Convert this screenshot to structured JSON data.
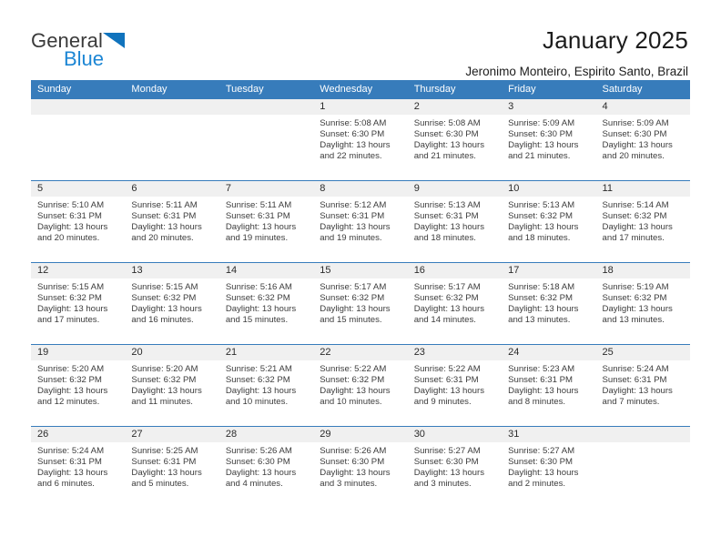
{
  "brand": {
    "name_part1": "General",
    "name_part2": "Blue",
    "triangle_color": "#1073bd",
    "blue_color": "#1c86d4"
  },
  "header": {
    "title": "January 2025",
    "subtitle": "Jeronimo Monteiro, Espirito Santo, Brazil"
  },
  "calendar": {
    "header_bg": "#377cbb",
    "daynum_bg": "#f0f0f0",
    "weekday_headers": [
      "Sunday",
      "Monday",
      "Tuesday",
      "Wednesday",
      "Thursday",
      "Friday",
      "Saturday"
    ],
    "weeks": [
      [
        {
          "day": "",
          "empty": true,
          "sunrise": "",
          "sunset": "",
          "daylight1": "",
          "daylight2": ""
        },
        {
          "day": "",
          "empty": true,
          "sunrise": "",
          "sunset": "",
          "daylight1": "",
          "daylight2": ""
        },
        {
          "day": "",
          "empty": true,
          "sunrise": "",
          "sunset": "",
          "daylight1": "",
          "daylight2": ""
        },
        {
          "day": "1",
          "empty": false,
          "sunrise": "Sunrise: 5:08 AM",
          "sunset": "Sunset: 6:30 PM",
          "daylight1": "Daylight: 13 hours",
          "daylight2": "and 22 minutes."
        },
        {
          "day": "2",
          "empty": false,
          "sunrise": "Sunrise: 5:08 AM",
          "sunset": "Sunset: 6:30 PM",
          "daylight1": "Daylight: 13 hours",
          "daylight2": "and 21 minutes."
        },
        {
          "day": "3",
          "empty": false,
          "sunrise": "Sunrise: 5:09 AM",
          "sunset": "Sunset: 6:30 PM",
          "daylight1": "Daylight: 13 hours",
          "daylight2": "and 21 minutes."
        },
        {
          "day": "4",
          "empty": false,
          "sunrise": "Sunrise: 5:09 AM",
          "sunset": "Sunset: 6:30 PM",
          "daylight1": "Daylight: 13 hours",
          "daylight2": "and 20 minutes."
        }
      ],
      [
        {
          "day": "5",
          "empty": false,
          "sunrise": "Sunrise: 5:10 AM",
          "sunset": "Sunset: 6:31 PM",
          "daylight1": "Daylight: 13 hours",
          "daylight2": "and 20 minutes."
        },
        {
          "day": "6",
          "empty": false,
          "sunrise": "Sunrise: 5:11 AM",
          "sunset": "Sunset: 6:31 PM",
          "daylight1": "Daylight: 13 hours",
          "daylight2": "and 20 minutes."
        },
        {
          "day": "7",
          "empty": false,
          "sunrise": "Sunrise: 5:11 AM",
          "sunset": "Sunset: 6:31 PM",
          "daylight1": "Daylight: 13 hours",
          "daylight2": "and 19 minutes."
        },
        {
          "day": "8",
          "empty": false,
          "sunrise": "Sunrise: 5:12 AM",
          "sunset": "Sunset: 6:31 PM",
          "daylight1": "Daylight: 13 hours",
          "daylight2": "and 19 minutes."
        },
        {
          "day": "9",
          "empty": false,
          "sunrise": "Sunrise: 5:13 AM",
          "sunset": "Sunset: 6:31 PM",
          "daylight1": "Daylight: 13 hours",
          "daylight2": "and 18 minutes."
        },
        {
          "day": "10",
          "empty": false,
          "sunrise": "Sunrise: 5:13 AM",
          "sunset": "Sunset: 6:32 PM",
          "daylight1": "Daylight: 13 hours",
          "daylight2": "and 18 minutes."
        },
        {
          "day": "11",
          "empty": false,
          "sunrise": "Sunrise: 5:14 AM",
          "sunset": "Sunset: 6:32 PM",
          "daylight1": "Daylight: 13 hours",
          "daylight2": "and 17 minutes."
        }
      ],
      [
        {
          "day": "12",
          "empty": false,
          "sunrise": "Sunrise: 5:15 AM",
          "sunset": "Sunset: 6:32 PM",
          "daylight1": "Daylight: 13 hours",
          "daylight2": "and 17 minutes."
        },
        {
          "day": "13",
          "empty": false,
          "sunrise": "Sunrise: 5:15 AM",
          "sunset": "Sunset: 6:32 PM",
          "daylight1": "Daylight: 13 hours",
          "daylight2": "and 16 minutes."
        },
        {
          "day": "14",
          "empty": false,
          "sunrise": "Sunrise: 5:16 AM",
          "sunset": "Sunset: 6:32 PM",
          "daylight1": "Daylight: 13 hours",
          "daylight2": "and 15 minutes."
        },
        {
          "day": "15",
          "empty": false,
          "sunrise": "Sunrise: 5:17 AM",
          "sunset": "Sunset: 6:32 PM",
          "daylight1": "Daylight: 13 hours",
          "daylight2": "and 15 minutes."
        },
        {
          "day": "16",
          "empty": false,
          "sunrise": "Sunrise: 5:17 AM",
          "sunset": "Sunset: 6:32 PM",
          "daylight1": "Daylight: 13 hours",
          "daylight2": "and 14 minutes."
        },
        {
          "day": "17",
          "empty": false,
          "sunrise": "Sunrise: 5:18 AM",
          "sunset": "Sunset: 6:32 PM",
          "daylight1": "Daylight: 13 hours",
          "daylight2": "and 13 minutes."
        },
        {
          "day": "18",
          "empty": false,
          "sunrise": "Sunrise: 5:19 AM",
          "sunset": "Sunset: 6:32 PM",
          "daylight1": "Daylight: 13 hours",
          "daylight2": "and 13 minutes."
        }
      ],
      [
        {
          "day": "19",
          "empty": false,
          "sunrise": "Sunrise: 5:20 AM",
          "sunset": "Sunset: 6:32 PM",
          "daylight1": "Daylight: 13 hours",
          "daylight2": "and 12 minutes."
        },
        {
          "day": "20",
          "empty": false,
          "sunrise": "Sunrise: 5:20 AM",
          "sunset": "Sunset: 6:32 PM",
          "daylight1": "Daylight: 13 hours",
          "daylight2": "and 11 minutes."
        },
        {
          "day": "21",
          "empty": false,
          "sunrise": "Sunrise: 5:21 AM",
          "sunset": "Sunset: 6:32 PM",
          "daylight1": "Daylight: 13 hours",
          "daylight2": "and 10 minutes."
        },
        {
          "day": "22",
          "empty": false,
          "sunrise": "Sunrise: 5:22 AM",
          "sunset": "Sunset: 6:32 PM",
          "daylight1": "Daylight: 13 hours",
          "daylight2": "and 10 minutes."
        },
        {
          "day": "23",
          "empty": false,
          "sunrise": "Sunrise: 5:22 AM",
          "sunset": "Sunset: 6:31 PM",
          "daylight1": "Daylight: 13 hours",
          "daylight2": "and 9 minutes."
        },
        {
          "day": "24",
          "empty": false,
          "sunrise": "Sunrise: 5:23 AM",
          "sunset": "Sunset: 6:31 PM",
          "daylight1": "Daylight: 13 hours",
          "daylight2": "and 8 minutes."
        },
        {
          "day": "25",
          "empty": false,
          "sunrise": "Sunrise: 5:24 AM",
          "sunset": "Sunset: 6:31 PM",
          "daylight1": "Daylight: 13 hours",
          "daylight2": "and 7 minutes."
        }
      ],
      [
        {
          "day": "26",
          "empty": false,
          "sunrise": "Sunrise: 5:24 AM",
          "sunset": "Sunset: 6:31 PM",
          "daylight1": "Daylight: 13 hours",
          "daylight2": "and 6 minutes."
        },
        {
          "day": "27",
          "empty": false,
          "sunrise": "Sunrise: 5:25 AM",
          "sunset": "Sunset: 6:31 PM",
          "daylight1": "Daylight: 13 hours",
          "daylight2": "and 5 minutes."
        },
        {
          "day": "28",
          "empty": false,
          "sunrise": "Sunrise: 5:26 AM",
          "sunset": "Sunset: 6:30 PM",
          "daylight1": "Daylight: 13 hours",
          "daylight2": "and 4 minutes."
        },
        {
          "day": "29",
          "empty": false,
          "sunrise": "Sunrise: 5:26 AM",
          "sunset": "Sunset: 6:30 PM",
          "daylight1": "Daylight: 13 hours",
          "daylight2": "and 3 minutes."
        },
        {
          "day": "30",
          "empty": false,
          "sunrise": "Sunrise: 5:27 AM",
          "sunset": "Sunset: 6:30 PM",
          "daylight1": "Daylight: 13 hours",
          "daylight2": "and 3 minutes."
        },
        {
          "day": "31",
          "empty": false,
          "sunrise": "Sunrise: 5:27 AM",
          "sunset": "Sunset: 6:30 PM",
          "daylight1": "Daylight: 13 hours",
          "daylight2": "and 2 minutes."
        },
        {
          "day": "",
          "empty": true,
          "sunrise": "",
          "sunset": "",
          "daylight1": "",
          "daylight2": ""
        }
      ]
    ]
  }
}
